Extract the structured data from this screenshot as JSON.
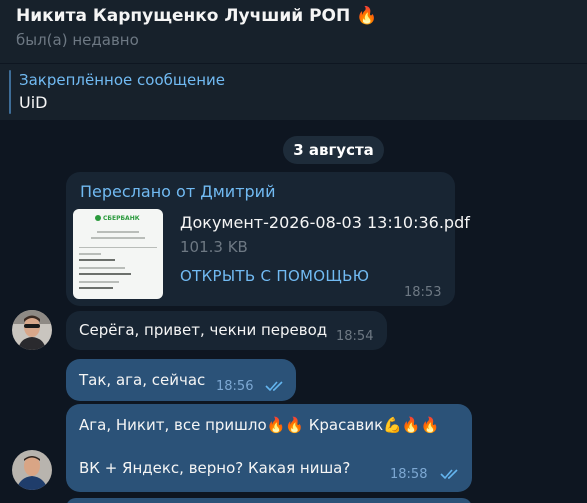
{
  "header": {
    "title": "Никита Карпущенко Лучший РОП 🔥",
    "status": "был(а) недавно"
  },
  "pinned": {
    "title": "Закреплённое сообщение",
    "text": "UiD"
  },
  "date_separator": "3 августа",
  "messages": [
    {
      "direction": "in",
      "forwarded_from": "Переслано от Дмитрий",
      "document": {
        "name": "Документ-2026-08-03 13:10:36.pdf",
        "size": "101.3 KB",
        "action": "ОТКРЫТЬ С ПОМОЩЬЮ"
      },
      "time": "18:53"
    },
    {
      "direction": "in",
      "text": "Серёга, привет, чекни перевод",
      "time": "18:54"
    },
    {
      "direction": "out",
      "text": "Так, ага, сейчас",
      "time": "18:56",
      "read": true
    },
    {
      "direction": "out",
      "lines": [
        "Ага, Никит, все пришло🔥🔥 Красавик💪🔥🔥",
        "ВК + Яндекс, верно? Какая ниша?"
      ],
      "time": "18:58",
      "read": true
    }
  ],
  "thumbnail": {
    "bank_logo": "СБЕРБАНК"
  },
  "colors": {
    "background": "#0e1621",
    "header": "#17212b",
    "incoming_bubble": "#182533",
    "outgoing_bubble": "#2b5278",
    "accent": "#71baf2"
  }
}
